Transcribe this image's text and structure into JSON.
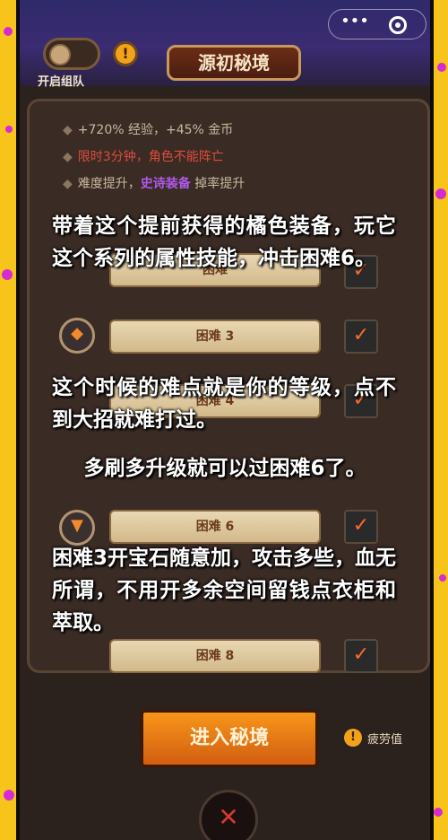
{
  "header": {
    "toggle_label": "开启组队",
    "warn_glyph": "!",
    "title": "源初秘境",
    "more_glyph": "•••"
  },
  "bonuses": {
    "line1": "+720% 经验，+45% 金币",
    "line2": "限时3分钟，角色不能阵亡",
    "line3_prefix": "难度提升，",
    "line3_highlight": "史诗装备",
    "line3_suffix": " 掉率提升"
  },
  "difficulties": [
    {
      "label": "困难",
      "checked": true
    },
    {
      "label": "困难 3",
      "checked": true
    },
    {
      "label": "困难 4",
      "checked": true
    },
    {
      "label": "困难 6",
      "checked": true
    },
    {
      "label": "困难 8",
      "checked": true
    }
  ],
  "overlay_text": {
    "para1": "带着这个提前获得的橘色装备，玩它这个系列的属性技能，冲击困难6。",
    "para2_a": "这个时候的难点就是你的等级，点不到大招就难打过。",
    "para2_b": "多刷多升级就可以过困难6了。",
    "para3": "困难3开宝石随意加，攻击多些，血无所谓，不用开多余空间留钱点衣柜和萃取。"
  },
  "footer": {
    "enter_button": "进入秘境",
    "fatigue_glyph": "!",
    "fatigue_label": "疲劳值"
  },
  "colors": {
    "background": "#f6c41a",
    "accent_orange": "#f08a2a",
    "epic_purple": "#b05ae8",
    "warning_red": "#e04c3b"
  }
}
